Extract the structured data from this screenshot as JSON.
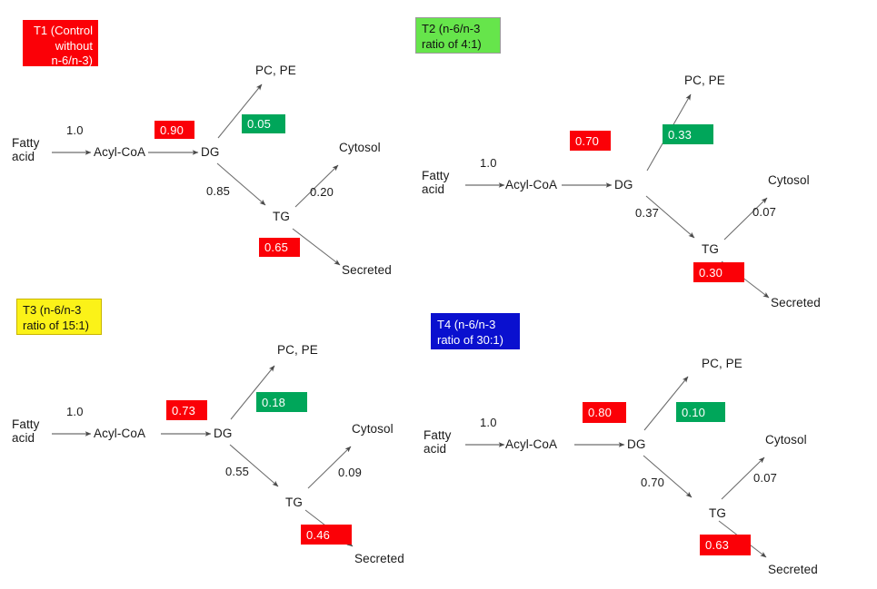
{
  "figure": {
    "type": "diagram",
    "description": "Fatty acid flux pathway diagrams for four dietary treatments",
    "node_labels": {
      "fatty_acid": "Fatty\nacid",
      "acyl_coa": "Acyl-CoA",
      "dg": "DG",
      "pc_pe": "PC, PE",
      "tg": "TG",
      "cytosol": "Cytosol",
      "secreted": "Secreted"
    },
    "colors": {
      "red_chip": "#FB0007",
      "green_chip": "#00A65A",
      "t1_title_bg": "#FB0007",
      "t2_title_bg": "#66E54B",
      "t3_title_bg": "#FBF218",
      "t4_title_bg": "#0A10CF",
      "arrow": "#595959",
      "text": "#1A1A1A"
    }
  },
  "panels": [
    {
      "id": "T1",
      "title": "T1 (Control\nwithout\nn-6/n-3)",
      "fluxes": {
        "fattyacid_to_acylcoa": "1.0",
        "acylcoa_to_dg": "0.90",
        "dg_to_pcpe": "0.05",
        "dg_to_tg": "0.85",
        "tg_to_cytosol": "0.20",
        "tg_to_secreted": "0.65"
      }
    },
    {
      "id": "T2",
      "title": "T2 (n-6/n-3\nratio of 4:1)",
      "fluxes": {
        "fattyacid_to_acylcoa": "1.0",
        "acylcoa_to_dg": "0.70",
        "dg_to_pcpe": "0.33",
        "dg_to_tg": "0.37",
        "tg_to_cytosol": "0.07",
        "tg_to_secreted": "0.30"
      }
    },
    {
      "id": "T3",
      "title": "T3 (n-6/n-3\nratio of 15:1)",
      "fluxes": {
        "fattyacid_to_acylcoa": "1.0",
        "acylcoa_to_dg": "0.73",
        "dg_to_pcpe": "0.18",
        "dg_to_tg": "0.55",
        "tg_to_cytosol": "0.09",
        "tg_to_secreted": "0.46"
      }
    },
    {
      "id": "T4",
      "title": "T4 (n-6/n-3\nratio of 30:1)",
      "fluxes": {
        "fattyacid_to_acylcoa": "1.0",
        "acylcoa_to_dg": "0.80",
        "dg_to_pcpe": "0.10",
        "dg_to_tg": "0.70",
        "tg_to_cytosol": "0.07",
        "tg_to_secreted": "0.63"
      }
    }
  ]
}
